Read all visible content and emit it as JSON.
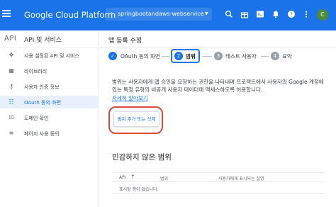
{
  "topbar": {
    "app_title": "Google Cloud Platform",
    "project_name": "springbootandaws-webservice",
    "avatar_letter": "C",
    "icons": [
      "search-icon",
      "gift-icon",
      "terminal-icon",
      "alert-icon",
      "help-icon",
      "more-vert-icon"
    ]
  },
  "sidebar": {
    "api_label": "API",
    "title": "API 및 서비스",
    "items": [
      {
        "label": "사용 설정된 API 및 서비스",
        "icon": "move-icon"
      },
      {
        "label": "라이브러리",
        "icon": "library-icon"
      },
      {
        "label": "사용자 인증 정보",
        "icon": "key-icon"
      },
      {
        "label": "OAuth 동의 화면",
        "icon": "consent-icon"
      },
      {
        "label": "도메인 확인",
        "icon": "checkbox-icon"
      },
      {
        "label": "페이지 사용 동의",
        "icon": "settings-list-icon"
      }
    ]
  },
  "main": {
    "page_title": "앱 등록 수정",
    "steps": [
      {
        "number": "✓",
        "label": "OAuth 동의 화면"
      },
      {
        "number": "2",
        "label": "범위"
      },
      {
        "number": "3",
        "label": "테스트 사용자"
      },
      {
        "number": "4",
        "label": "요약"
      }
    ],
    "description": "범위는 사용자에게 앱 승인을 요청하는 권한을 나타내며 프로젝트에서 사용자의 Google 계정에 있는 특정 유형의 비공개 사용자 데이터에 액세스하도록 허용합니다.",
    "learn_more": "자세히 알아보기",
    "scope_button": "범위 추가 또는 삭제",
    "section_title": "민감하지 않은 범위",
    "table": {
      "headers": [
        "API",
        "범위",
        "사용자에게 표시되는 설명"
      ],
      "empty_text": "표시할 행이 없습니다."
    }
  }
}
